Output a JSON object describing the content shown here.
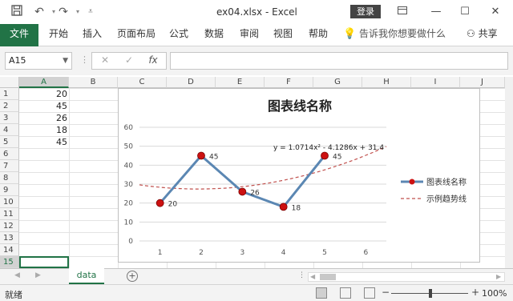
{
  "window": {
    "title": "ex04.xlsx  -  Excel",
    "login_label": "登录",
    "save_icon": "save-icon",
    "undo_icon": "undo-icon",
    "redo_icon": "redo-icon"
  },
  "ribbon": {
    "tabs": [
      "文件",
      "开始",
      "插入",
      "页面布局",
      "公式",
      "数据",
      "审阅",
      "视图",
      "帮助"
    ],
    "tell_me": "告诉我你想要做什么",
    "share": "共享"
  },
  "formula_bar": {
    "name_box": "A15",
    "fx": "fx",
    "value": ""
  },
  "grid": {
    "columns": [
      "A",
      "B",
      "C",
      "D",
      "E",
      "F",
      "G",
      "H",
      "I",
      "J"
    ],
    "rows": [
      "1",
      "2",
      "3",
      "4",
      "5",
      "6",
      "7",
      "8",
      "9",
      "10",
      "11",
      "12",
      "13",
      "14",
      "15"
    ],
    "values": [
      "20",
      "45",
      "26",
      "18",
      "45"
    ],
    "selected_cell": "A15"
  },
  "chart_data": {
    "type": "line",
    "title": "图表线名称",
    "categories": [
      "1",
      "2",
      "3",
      "4",
      "5",
      "6"
    ],
    "series": [
      {
        "name": "图表线名称",
        "values": [
          20,
          45,
          26,
          18,
          45
        ],
        "color": "#5b87b3",
        "marker_color": "#cc1111"
      }
    ],
    "trendline": {
      "name": "示例趋势线",
      "equation": "y = 1.0714x² - 4.1286x + 31.4",
      "coefficients": [
        1.0714,
        -4.1286,
        31.4
      ],
      "color": "#c0504d"
    },
    "data_labels": [
      "20",
      "45",
      "26",
      "18",
      "45"
    ],
    "yticks": [
      "0",
      "10",
      "20",
      "30",
      "40",
      "50",
      "60"
    ],
    "ylim": [
      0,
      60
    ],
    "grid": true,
    "legend": "right"
  },
  "sheets": {
    "active": "data",
    "add_label": "+"
  },
  "status": {
    "ready": "就绪",
    "zoom": "100%"
  }
}
